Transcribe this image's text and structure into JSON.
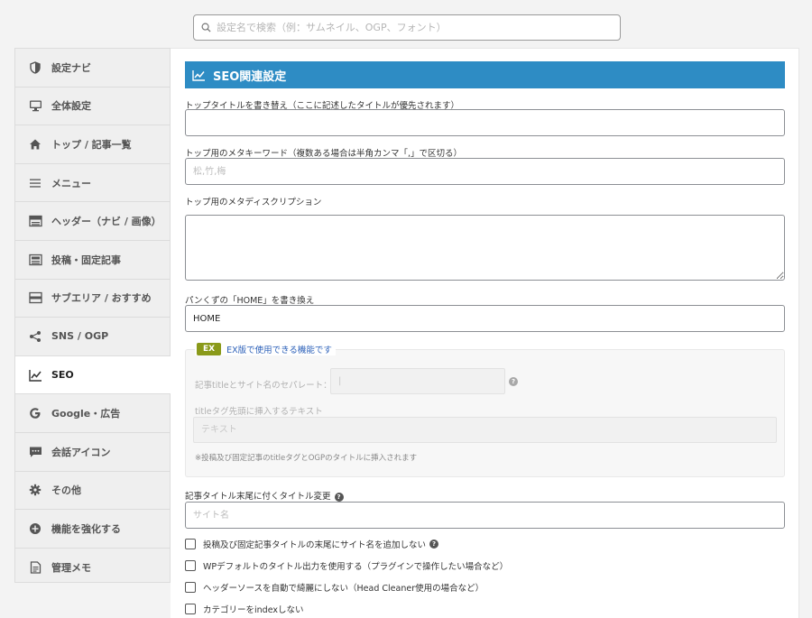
{
  "search": {
    "placeholder": "設定名で検索（例：サムネイル、OGP、フォント）"
  },
  "sidebar": {
    "items": [
      {
        "label": "設定ナビ",
        "icon": "shield-icon"
      },
      {
        "label": "全体設定",
        "icon": "monitor-icon"
      },
      {
        "label": "トップ / 記事一覧",
        "icon": "home-icon"
      },
      {
        "label": "メニュー",
        "icon": "menu-icon"
      },
      {
        "label": "ヘッダー（ナビ / 画像）",
        "icon": "header-icon"
      },
      {
        "label": "投稿・固定記事",
        "icon": "post-icon"
      },
      {
        "label": "サブエリア / おすすめ",
        "icon": "subarea-icon"
      },
      {
        "label": "SNS / OGP",
        "icon": "share-icon"
      },
      {
        "label": "SEO",
        "icon": "chart-line-icon",
        "active": true
      },
      {
        "label": "Google・広告",
        "icon": "google-icon"
      },
      {
        "label": "会話アイコン",
        "icon": "chat-icon"
      },
      {
        "label": "その他",
        "icon": "gear-icon"
      },
      {
        "label": "機能を強化する",
        "icon": "plus-circle-icon"
      },
      {
        "label": "管理メモ",
        "icon": "memo-icon"
      }
    ]
  },
  "section": {
    "title": "SEO関連設定"
  },
  "fields": {
    "top_title": {
      "label": "トップタイトルを書き替え（ここに記述したタイトルが優先されます）",
      "value": ""
    },
    "top_keywords": {
      "label": "トップ用のメタキーワード（複数ある場合は半角カンマ「,」で区切る）",
      "placeholder": "松,竹,梅"
    },
    "top_description": {
      "label": "トップ用のメタディスクリプション",
      "value": ""
    },
    "breadcrumb_home": {
      "label": "パンくずの「HOME」を書き換え",
      "value": "HOME"
    }
  },
  "ex_box": {
    "badge": "EX",
    "legend": "EX版で使用できる機能です",
    "separator_label": "記事titleとサイト名のセパレート：",
    "separator_value": "|",
    "prefix_label": "titleタグ先頭に挿入するテキスト",
    "prefix_placeholder": "テキスト",
    "note": "※投稿及び固定記事のtitleタグとOGPのタイトルに挿入されます"
  },
  "title_suffix": {
    "label": "記事タイトル末尾に付くタイトル変更",
    "placeholder": "サイト名"
  },
  "checkboxes": [
    {
      "label": "投稿及び固定記事タイトルの末尾にサイト名を追加しない",
      "checked": false,
      "help": true
    },
    {
      "label": "WPデフォルトのタイトル出力を使用する（プラグインで操作したい場合など）",
      "checked": false
    },
    {
      "label": "ヘッダーソースを自動で綺麗にしない（Head Cleaner使用の場合など）",
      "checked": false
    },
    {
      "label": "カテゴリーをindexしない",
      "checked": false
    }
  ],
  "colors": {
    "accent": "#2e8cc4",
    "ex_badge": "#8a9a1a",
    "ex_link": "#2a5fb8"
  }
}
